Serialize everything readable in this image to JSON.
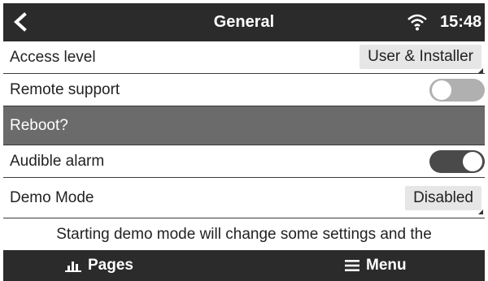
{
  "header": {
    "title": "General",
    "time": "15:48",
    "back_icon": "back-chevron-icon",
    "status_icon": "wifi-icon"
  },
  "rows": [
    {
      "label": "Access level",
      "control": "value",
      "value": "User & Installer"
    },
    {
      "label": "Remote support",
      "control": "toggle",
      "state": "off"
    },
    {
      "label": "Reboot?",
      "control": "none"
    },
    {
      "label": "Audible alarm",
      "control": "toggle",
      "state": "on"
    },
    {
      "label": "Demo Mode",
      "control": "value",
      "value": "Disabled"
    }
  ],
  "info_text": "Starting demo mode will change some settings and the",
  "footer": {
    "pages_label": "Pages",
    "pages_icon": "bar-chart-icon",
    "menu_label": "Menu",
    "menu_icon": "hamburger-menu-icon"
  },
  "colors": {
    "bar_bg": "#2b2b2b",
    "selected_row_bg": "#6b6b6b",
    "toggle_on": "#4a4a4a",
    "toggle_off": "#b0b0b0",
    "value_button_bg": "#e6e6e6"
  }
}
